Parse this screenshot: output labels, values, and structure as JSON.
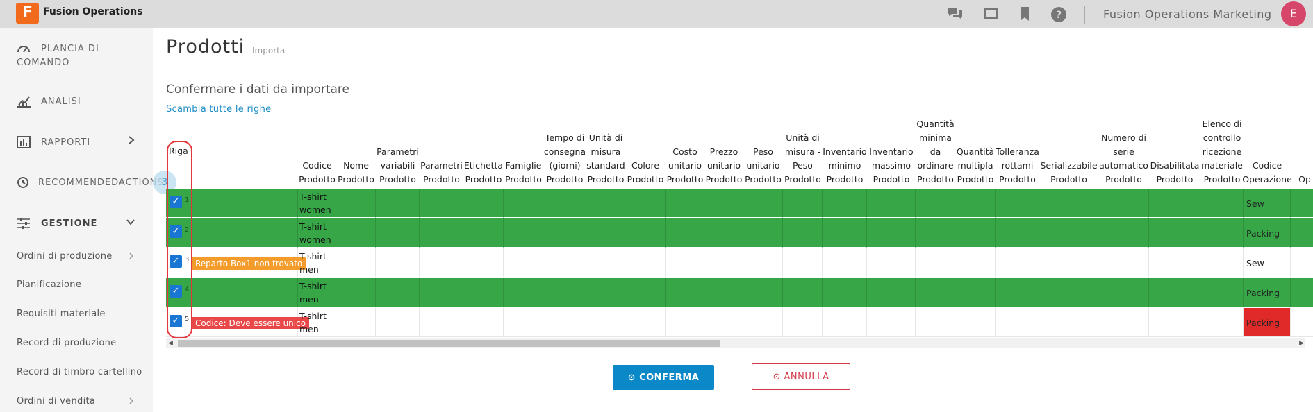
{
  "app": {
    "title": "Fusion Operations",
    "logo_letter": "F",
    "org_name": "Fusion Operations Marketing",
    "user_initial": "E"
  },
  "header_icons": [
    "chat-icon",
    "screen-icon",
    "bookmark-icon",
    "help-icon"
  ],
  "sidebar": {
    "main": [
      {
        "label": "PLANCIA DI",
        "label2": "COMANDO",
        "icon": "gauge-icon"
      },
      {
        "label": "ANALISI",
        "icon": "chart-icon"
      },
      {
        "label": "RAPPORTI",
        "icon": "report-icon"
      },
      {
        "label": "RECOMMENDEDACTIONS",
        "icon": "history-icon"
      },
      {
        "label": "GESTIONE",
        "icon": "sliders-icon"
      }
    ],
    "badge": "3",
    "sub": [
      "Ordini di produzione",
      "Pianificazione",
      "Requisiti materiale",
      "Record di produzione",
      "Record di timbro cartellino",
      "Ordini di vendita"
    ]
  },
  "page": {
    "title": "Prodotti",
    "subtitle": "Importa",
    "heading": "Confermare i dati da importare",
    "swap_link": "Scambia tutte le righe"
  },
  "table": {
    "headers": [
      "Riga",
      "Codice Prodotto",
      "Nome Prodotto",
      "Parametri variabili Prodotto",
      "Parametri Prodotto",
      "Etichetta Prodotto",
      "Famiglie Prodotto",
      "Tempo di consegna (giorni) Prodotto",
      "Unità di misura standard Prodotto",
      "Colore Prodotto",
      "Costo unitario Prodotto",
      "Prezzo unitario Prodotto",
      "Peso unitario Prodotto",
      "Unità di misura - Peso Prodotto",
      "Inventario minimo Prodotto",
      "Inventario massimo Prodotto",
      "Quantità minima da ordinare Prodotto",
      "Quantità multipla Prodotto",
      "Tolleranza rottami Prodotto",
      "Serializzabile Prodotto",
      "Numero di serie automatico Prodotto",
      "Disabilitata Prodotto",
      "Elenco di controllo ricezione materiale Prodotto",
      "Codice Operazione",
      "Op"
    ],
    "rows": [
      {
        "num": "1",
        "status": "green",
        "code": "T-shirt women",
        "error": "",
        "error_type": "",
        "operation": "Sew",
        "op_error": false
      },
      {
        "num": "2",
        "status": "green",
        "code": "T-shirt women",
        "error": "",
        "error_type": "",
        "operation": "Packing",
        "op_error": false
      },
      {
        "num": "3",
        "status": "white",
        "code": "T-shirt men",
        "error": "Reparto Box1 non trovato",
        "error_type": "orange",
        "operation": "Sew",
        "op_error": false
      },
      {
        "num": "4",
        "status": "green",
        "code": "T-shirt men",
        "error": "",
        "error_type": "",
        "operation": "Packing",
        "op_error": false
      },
      {
        "num": "5",
        "status": "white",
        "code": "T-shirt men",
        "error": "Codice: Deve essere unico",
        "error_type": "red",
        "operation": "Packing",
        "op_error": true
      }
    ]
  },
  "buttons": {
    "confirm": "⊙ CONFERMA",
    "cancel": "⊙ ANNULLA"
  },
  "colors": {
    "green_row": "#36a647",
    "accent": "#0a88c8",
    "error_red": "#e02a2a",
    "warning_orange": "#f39b2b",
    "cancel_red": "#d23a4a"
  }
}
